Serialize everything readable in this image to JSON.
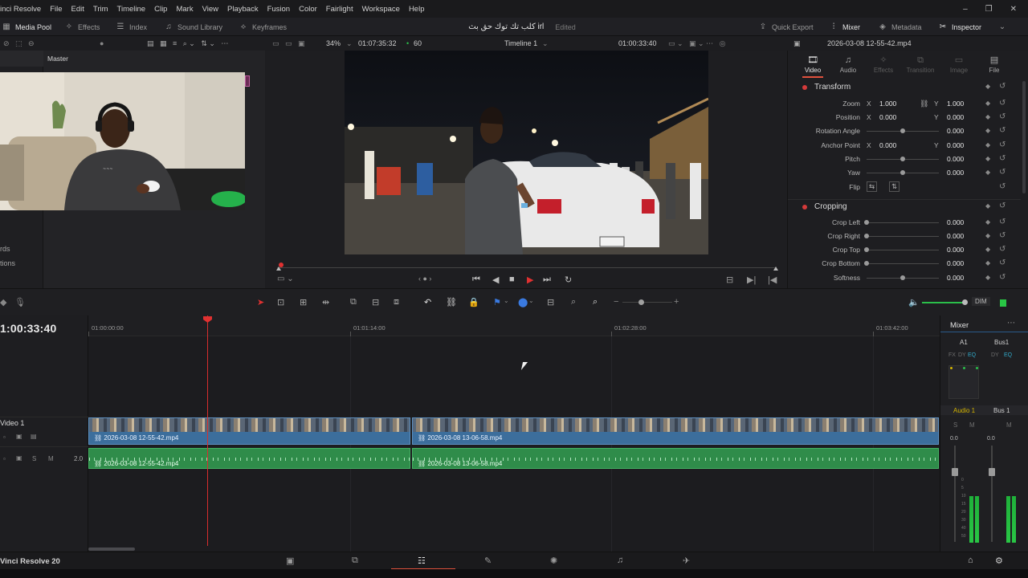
{
  "menubar": {
    "items": [
      "inci Resolve",
      "File",
      "Edit",
      "Trim",
      "Timeline",
      "Clip",
      "Mark",
      "View",
      "Playback",
      "Fusion",
      "Color",
      "Fairlight",
      "Workspace",
      "Help"
    ],
    "window_controls": [
      "–",
      "❐",
      "✕"
    ]
  },
  "toolbar": {
    "media_pool": "Media Pool",
    "effects": "Effects",
    "index": "Index",
    "sound_library": "Sound Library",
    "keyframes": "Keyframes",
    "project_title": "كلب تك توك حق بث irl",
    "status": "Edited",
    "quick_export": "Quick Export",
    "mixer": "Mixer",
    "metadata": "Metadata",
    "inspector": "Inspector"
  },
  "viewer_bar": {
    "zoom": "34%",
    "source_timecode": "01:07:35:32",
    "fps": "60",
    "timeline_name": "Timeline 1",
    "timecode": "01:00:33:40",
    "clip_name": "2026-03-08 12-55-42.mp4"
  },
  "media_pool": {
    "bin": "Master",
    "sidebar": [
      "rds",
      "tions"
    ]
  },
  "inspector": {
    "tabs": [
      {
        "label": "Video",
        "icon": "🎞",
        "active": true
      },
      {
        "label": "Audio",
        "icon": "♫",
        "active": false
      },
      {
        "label": "Effects",
        "icon": "✧",
        "active": false
      },
      {
        "label": "Transition",
        "icon": "⧉",
        "active": false
      },
      {
        "label": "Image",
        "icon": "▭",
        "active": false
      },
      {
        "label": "File",
        "icon": "▤",
        "active": false
      }
    ],
    "transform": {
      "title": "Transform",
      "zoom_label": "Zoom",
      "zoom_x": "1.000",
      "zoom_y": "1.000",
      "position_label": "Position",
      "position_x": "0.000",
      "position_y": "0.000",
      "rotation_label": "Rotation Angle",
      "rotation": "0.000",
      "anchor_label": "Anchor Point",
      "anchor_x": "0.000",
      "anchor_y": "0.000",
      "pitch_label": "Pitch",
      "pitch": "0.000",
      "yaw_label": "Yaw",
      "yaw": "0.000",
      "flip_label": "Flip",
      "x": "X",
      "y": "Y"
    },
    "cropping": {
      "title": "Cropping",
      "left_label": "Crop Left",
      "left": "0.000",
      "right_label": "Crop Right",
      "right": "0.000",
      "top_label": "Crop Top",
      "top": "0.000",
      "bottom_label": "Crop Bottom",
      "bottom": "0.000",
      "softness_label": "Softness",
      "softness": "0.000"
    }
  },
  "timeline": {
    "timecode": "1:00:33:40",
    "ruler": [
      "01:00:00:00",
      "01:01:14:00",
      "01:02:28:00",
      "01:03:42:00"
    ],
    "video_track": "Video 1",
    "audio_level": "2.0",
    "clips": {
      "v1": "2026-03-08 12-55-42.mp4",
      "v2": "2026-03-08 13-06-58.mp4",
      "a1": "2026-03-08 12-55-42.mp4",
      "a2": "2026-03-08 13-06-58.mp4"
    },
    "dim": "DIM"
  },
  "mixer": {
    "title": "Mixer",
    "ch1": "A1",
    "ch2": "Bus1",
    "fx": "FX",
    "dy": "DY",
    "eq": "EQ",
    "ch1_name": "Audio 1",
    "ch2_name": "Bus 1",
    "s": "S",
    "m": "M",
    "ch1_val": "0.0",
    "ch2_val": "0.0",
    "scale": [
      "0",
      "5",
      "10",
      "15",
      "20",
      "30",
      "40",
      "50"
    ]
  },
  "pagebar": {
    "app": "Vinci Resolve 20"
  },
  "colors": {
    "accent": "#e0513d",
    "video_clip": "#3c6e9c",
    "audio_clip": "#2f8c4a",
    "playhead": "#d92e2e",
    "meter": "#29c645"
  }
}
